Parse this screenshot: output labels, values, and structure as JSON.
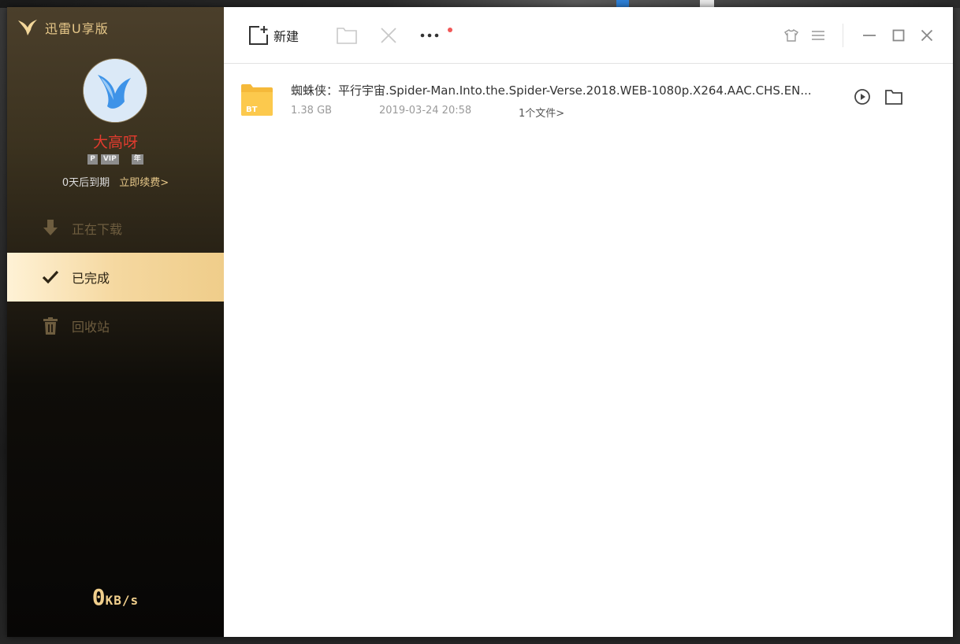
{
  "app": {
    "title": "迅雷U享版"
  },
  "user": {
    "name": "大高呀",
    "badges": [
      "P",
      "VIP",
      "年"
    ],
    "expire_text": "0天后到期",
    "renew_label": "立即续费>"
  },
  "nav": {
    "items": [
      {
        "label": "正在下载",
        "icon": "download-arrow-icon",
        "active": false
      },
      {
        "label": "已完成",
        "icon": "checkmark-icon",
        "active": true
      },
      {
        "label": "回收站",
        "icon": "trash-icon",
        "active": false
      }
    ]
  },
  "speed": {
    "value": "0",
    "unit": "KB/s"
  },
  "toolbar": {
    "new_label": "新建",
    "icons": [
      "new-task-icon",
      "folder-icon",
      "delete-icon",
      "more-icon",
      "skin-icon",
      "menu-icon",
      "minimize-icon",
      "maximize-icon",
      "close-icon"
    ]
  },
  "tasks": [
    {
      "name": "蜘蛛侠：平行宇宙.Spider-Man.Into.the.Spider-Verse.2018.WEB-1080p.X264.AAC.CHS.EN...",
      "size": "1.38 GB",
      "date": "2019-03-24 20:58",
      "files": "1个文件>",
      "type_label": "BT"
    }
  ],
  "colors": {
    "accent_gold": "#e7c889",
    "username_red": "#e23b2e",
    "active_nav": "#f5d8a0"
  }
}
